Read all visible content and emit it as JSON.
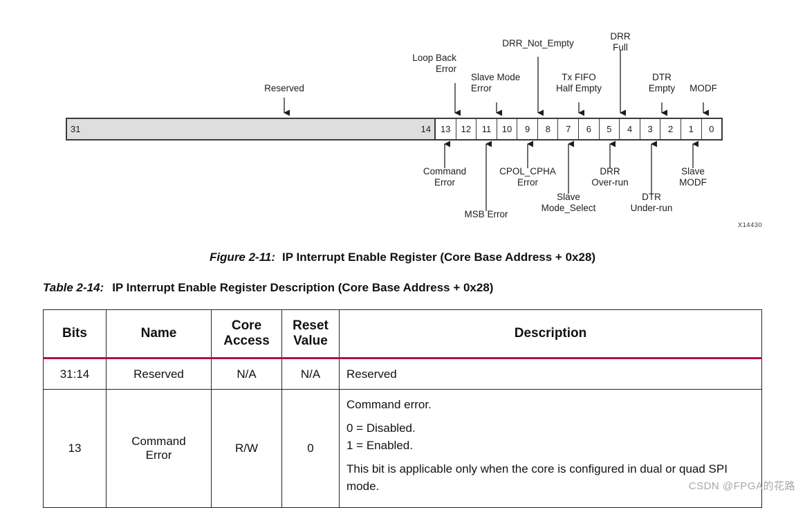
{
  "figure": {
    "register": {
      "reserved_label": "Reserved",
      "high_bit": "31",
      "low_bit": "14",
      "bits": [
        "13",
        "12",
        "11",
        "10",
        "9",
        "8",
        "7",
        "6",
        "5",
        "4",
        "3",
        "2",
        "1",
        "0"
      ]
    },
    "top_labels": [
      {
        "text": "Reserved",
        "bit": "reserved"
      },
      {
        "text": "Loop Back\nError",
        "bit": "13"
      },
      {
        "text": "Slave Mode\nError",
        "bit": "12"
      },
      {
        "text": "DRR_Not_Empty",
        "bit": "10"
      },
      {
        "text": "Tx FIFO\nHalf Empty",
        "bit": "8"
      },
      {
        "text": "DRR\nFull",
        "bit": "6"
      },
      {
        "text": "DTR\nEmpty",
        "bit": "4"
      },
      {
        "text": "MODF",
        "bit": "2"
      }
    ],
    "bottom_labels": [
      {
        "text": "Command\nError",
        "bit": "13"
      },
      {
        "text": "MSB Error",
        "bit": "11"
      },
      {
        "text": "CPOL_CPHA\nError",
        "bit": "9"
      },
      {
        "text": "Slave\nMode_Select",
        "bit": "7"
      },
      {
        "text": "DRR\nOver-run",
        "bit": "5"
      },
      {
        "text": "DTR\nUnder-run",
        "bit": "3"
      },
      {
        "text": "Slave\nMODF",
        "bit": "1"
      }
    ],
    "x_tag": "X14430",
    "caption": {
      "number": "Figure 2-11:",
      "title": "IP Interrupt Enable Register (Core Base Address + 0x28)"
    }
  },
  "table": {
    "caption": {
      "number": "Table 2-14:",
      "title": "IP Interrupt Enable Register Description (Core Base Address + 0x28)"
    },
    "headers": [
      "Bits",
      "Name",
      "Core\nAccess",
      "Reset\nValue",
      "Description"
    ],
    "header_bits": "Bits",
    "header_name": "Name",
    "header_core_access_l1": "Core",
    "header_core_access_l2": "Access",
    "header_reset_l1": "Reset",
    "header_reset_l2": "Value",
    "header_description": "Description",
    "rows": [
      {
        "bits": "31:14",
        "name": "Reserved",
        "core_access": "N/A",
        "reset_value": "N/A",
        "description_lines": [
          "Reserved"
        ]
      },
      {
        "bits": "13",
        "name_l1": "Command",
        "name_l2": "Error",
        "core_access": "R/W",
        "reset_value": "0",
        "desc_line1": "Command error.",
        "desc_line2": "0 = Disabled.",
        "desc_line3": "1 = Enabled.",
        "desc_line4": "This bit is applicable only when the core is configured in dual or quad SPI mode."
      }
    ]
  },
  "watermark": "CSDN @FPGA的花路",
  "colors": {
    "accent_rule": "#b01048",
    "reserved_fill": "#dedede",
    "border": "#222222"
  }
}
